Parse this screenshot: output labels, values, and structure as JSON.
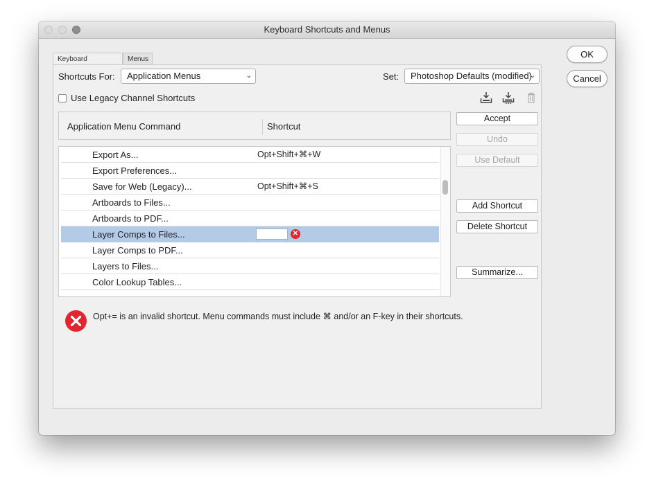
{
  "window": {
    "title": "Keyboard Shortcuts and Menus"
  },
  "tabs": [
    {
      "label": "Keyboard Shortcuts"
    },
    {
      "label": "Menus"
    }
  ],
  "shortcuts_for": {
    "label": "Shortcuts For:",
    "value": "Application Menus"
  },
  "set": {
    "label": "Set:",
    "value": "Photoshop Defaults (modified)"
  },
  "legacy_checkbox": {
    "label": "Use Legacy Channel Shortcuts",
    "checked": false
  },
  "icons": [
    "save-set-icon",
    "save-set-as-icon",
    "delete-set-icon"
  ],
  "table": {
    "headers": [
      "Application Menu Command",
      "Shortcut"
    ],
    "rows": [
      {
        "command": "Export As...",
        "shortcut": "Opt+Shift+⌘+W"
      },
      {
        "command": "Export Preferences...",
        "shortcut": ""
      },
      {
        "command": "Save for Web (Legacy)...",
        "shortcut": "Opt+Shift+⌘+S"
      },
      {
        "command": "Artboards to Files...",
        "shortcut": ""
      },
      {
        "command": "Artboards to PDF...",
        "shortcut": ""
      },
      {
        "command": "Layer Comps to Files...",
        "shortcut": "",
        "selected": true
      },
      {
        "command": "Layer Comps to PDF...",
        "shortcut": ""
      },
      {
        "command": "Layers to Files...",
        "shortcut": ""
      },
      {
        "command": "Color Lookup Tables...",
        "shortcut": ""
      }
    ]
  },
  "side_buttons": {
    "accept": "Accept",
    "undo": "Undo",
    "use_default": "Use Default",
    "add_shortcut": "Add Shortcut",
    "delete_shortcut": "Delete Shortcut",
    "summarize": "Summarize..."
  },
  "dialog_buttons": {
    "ok": "OK",
    "cancel": "Cancel"
  },
  "error_message": "Opt+= is an invalid shortcut.  Menu commands must include ⌘ and/or an F-key in their shortcuts.",
  "colors": {
    "selection": "#b3cbe6",
    "error": "#e0262f"
  }
}
